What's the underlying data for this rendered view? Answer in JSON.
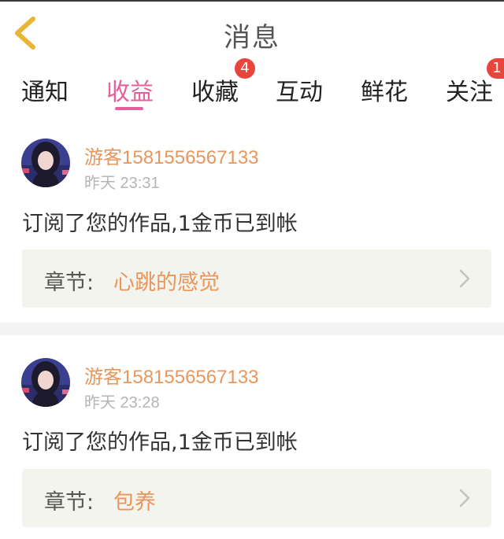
{
  "header": {
    "title": "消息",
    "back_icon": "chevron-left-icon"
  },
  "tabs": [
    {
      "label": "通知",
      "badge": ""
    },
    {
      "label": "收益",
      "badge": "",
      "active": true
    },
    {
      "label": "收藏",
      "badge": "4"
    },
    {
      "label": "互动",
      "badge": ""
    },
    {
      "label": "鲜花",
      "badge": ""
    },
    {
      "label": "关注",
      "badge": "1"
    }
  ],
  "messages": [
    {
      "username": "游客1581556567133",
      "time": "昨天 23:31",
      "text": "订阅了您的作品,1金币已到帐",
      "chapter_label": "章节:",
      "chapter_title": "心跳的感觉"
    },
    {
      "username": "游客1581556567133",
      "time": "昨天 23:28",
      "text": "订阅了您的作品,1金币已到帐",
      "chapter_label": "章节:",
      "chapter_title": "包养"
    }
  ],
  "colors": {
    "accent": "#e5609a",
    "username": "#e9965a",
    "badge": "#e8453c",
    "chapter_bg": "#f4f4ee"
  }
}
